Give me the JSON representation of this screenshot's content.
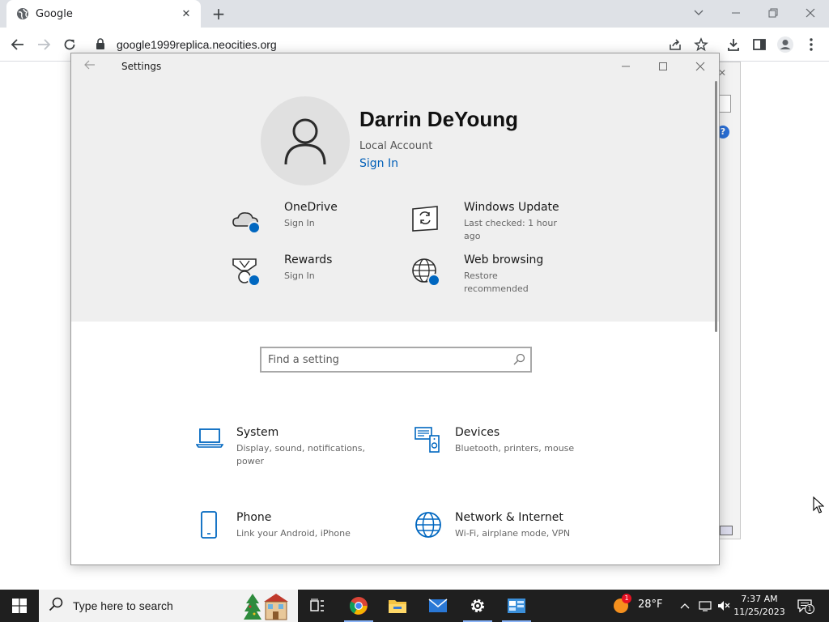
{
  "browser": {
    "tab_title": "Google",
    "url": "google1999replica.neocities.org"
  },
  "settings": {
    "window_title": "Settings",
    "user_name": "Darrin DeYoung",
    "account_type": "Local Account",
    "sign_in_link": "Sign In",
    "promos": [
      {
        "title": "OneDrive",
        "subtitle": "Sign In",
        "icon": "cloud-icon"
      },
      {
        "title": "Windows Update",
        "subtitle": "Last checked: 1 hour ago",
        "icon": "windows-update-icon"
      },
      {
        "title": "Rewards",
        "subtitle": "Sign In",
        "icon": "rewards-medal-icon"
      },
      {
        "title": "Web browsing",
        "subtitle": "Restore recommended",
        "icon": "globe-icon"
      }
    ],
    "search_placeholder": "Find a setting",
    "categories": [
      {
        "title": "System",
        "subtitle": "Display, sound, notifications, power",
        "icon": "laptop-icon"
      },
      {
        "title": "Devices",
        "subtitle": "Bluetooth, printers, mouse",
        "icon": "devices-icon"
      },
      {
        "title": "Phone",
        "subtitle": "Link your Android, iPhone",
        "icon": "phone-icon"
      },
      {
        "title": "Network & Internet",
        "subtitle": "Wi-Fi, airplane mode, VPN",
        "icon": "network-globe-icon"
      }
    ],
    "colors": {
      "accent": "#005fb8",
      "header_bg": "#efefef",
      "icon_blue": "#0067c0"
    }
  },
  "taskbar": {
    "search_placeholder": "Type here to search",
    "weather": "28°F",
    "weather_badge": "1",
    "time": "7:37 AM",
    "date": "11/25/2023",
    "notification_count": "1"
  }
}
